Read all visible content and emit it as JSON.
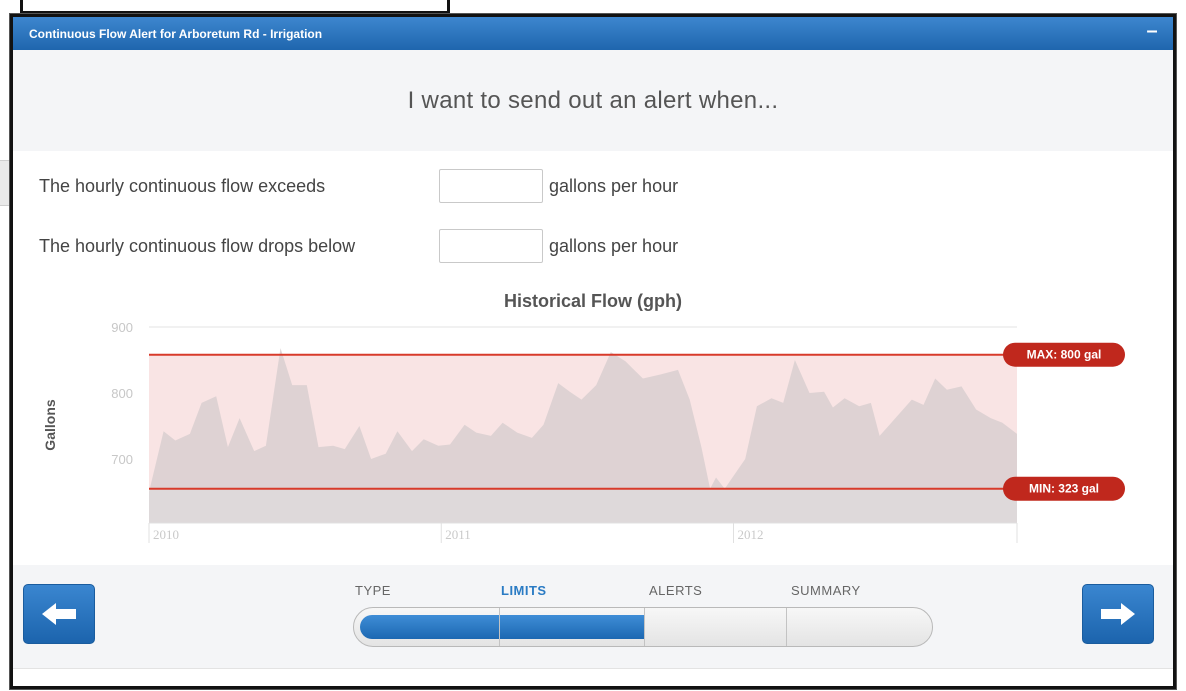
{
  "window": {
    "title": "Continuous Flow Alert for Arboretum Rd - Irrigation",
    "minimize_label": "–"
  },
  "heading": "I want to send out an alert when...",
  "limits": {
    "exceeds_label": "The hourly continuous flow exceeds",
    "exceeds_value": "",
    "exceeds_unit": "gallons per hour",
    "below_label": "The hourly continuous flow drops below",
    "below_value": "",
    "below_unit": "gallons per hour"
  },
  "chart_data": {
    "type": "area",
    "title": "Historical Flow (gph)",
    "ylabel": "Gallons",
    "xlabel": "",
    "ylim": [
      600,
      900
    ],
    "yticks": [
      700,
      800,
      900
    ],
    "xticks": [
      {
        "label": "2010",
        "x": 2010.0
      },
      {
        "label": "2011",
        "x": 2011.0
      },
      {
        "label": "2012",
        "x": 2012.0
      }
    ],
    "xlim": [
      2010.0,
      2012.97
    ],
    "grid": true,
    "series": [
      {
        "values": [
          [
            2010.0,
            650
          ],
          [
            2010.05,
            742
          ],
          [
            2010.09,
            728
          ],
          [
            2010.14,
            738
          ],
          [
            2010.18,
            785
          ],
          [
            2010.23,
            795
          ],
          [
            2010.27,
            718
          ],
          [
            2010.31,
            762
          ],
          [
            2010.36,
            712
          ],
          [
            2010.4,
            720
          ],
          [
            2010.45,
            868
          ],
          [
            2010.49,
            812
          ],
          [
            2010.54,
            812
          ],
          [
            2010.58,
            718
          ],
          [
            2010.63,
            720
          ],
          [
            2010.67,
            715
          ],
          [
            2010.72,
            750
          ],
          [
            2010.76,
            700
          ],
          [
            2010.81,
            708
          ],
          [
            2010.85,
            742
          ],
          [
            2010.9,
            712
          ],
          [
            2010.94,
            730
          ],
          [
            2010.99,
            720
          ],
          [
            2011.03,
            722
          ],
          [
            2011.08,
            752
          ],
          [
            2011.12,
            740
          ],
          [
            2011.17,
            735
          ],
          [
            2011.21,
            755
          ],
          [
            2011.26,
            740
          ],
          [
            2011.31,
            732
          ],
          [
            2011.35,
            752
          ],
          [
            2011.4,
            815
          ],
          [
            2011.44,
            802
          ],
          [
            2011.48,
            790
          ],
          [
            2011.53,
            812
          ],
          [
            2011.58,
            862
          ],
          [
            2011.63,
            848
          ],
          [
            2011.69,
            822
          ],
          [
            2011.75,
            828
          ],
          [
            2011.81,
            835
          ],
          [
            2011.85,
            790
          ],
          [
            2011.89,
            718
          ],
          [
            2011.92,
            655
          ],
          [
            2011.94,
            672
          ],
          [
            2011.97,
            655
          ],
          [
            2012.04,
            700
          ],
          [
            2012.08,
            780
          ],
          [
            2012.13,
            792
          ],
          [
            2012.17,
            785
          ],
          [
            2012.21,
            850
          ],
          [
            2012.26,
            800
          ],
          [
            2012.31,
            802
          ],
          [
            2012.34,
            778
          ],
          [
            2012.38,
            792
          ],
          [
            2012.43,
            780
          ],
          [
            2012.47,
            785
          ],
          [
            2012.5,
            735
          ],
          [
            2012.55,
            760
          ],
          [
            2012.61,
            790
          ],
          [
            2012.65,
            782
          ],
          [
            2012.69,
            822
          ],
          [
            2012.73,
            805
          ],
          [
            2012.78,
            810
          ],
          [
            2012.83,
            775
          ],
          [
            2012.88,
            762
          ],
          [
            2012.92,
            755
          ],
          [
            2012.97,
            738
          ]
        ]
      }
    ],
    "thresholds": [
      {
        "label": "MAX: 800 gal",
        "value": 858
      },
      {
        "label": "MIN: 323 gal",
        "value": 655
      }
    ],
    "colors": {
      "area": "#d9cfd0",
      "band": "#f9e4e4",
      "line": "#d83a2a",
      "badge": "#c0281d"
    }
  },
  "wizard": {
    "back_label": "Back",
    "next_label": "Next",
    "steps": [
      "TYPE",
      "LIMITS",
      "ALERTS",
      "SUMMARY"
    ],
    "active_step": 1,
    "progress": 0.5
  }
}
